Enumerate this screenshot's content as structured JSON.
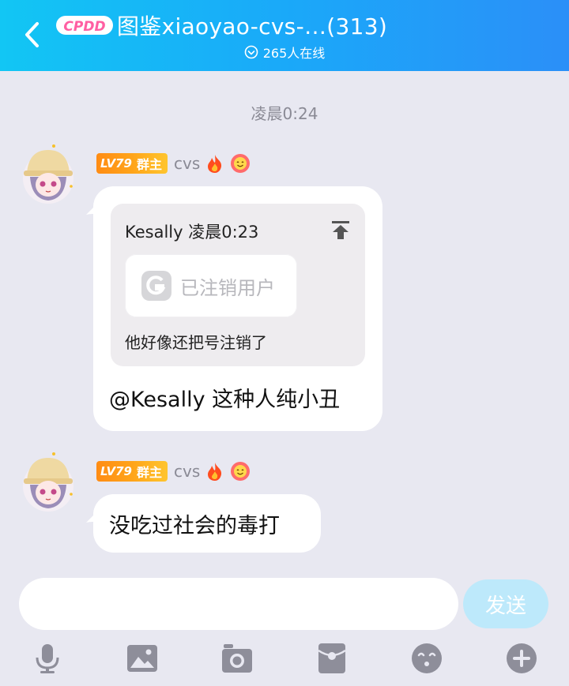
{
  "header": {
    "logo_text": "CPDD",
    "title": "图鉴xiaoyao-cvs-…(313)",
    "online": "265人在线"
  },
  "chat": {
    "timestamp": "凌晨0:24",
    "messages": [
      {
        "level": "LV79",
        "role": "群主",
        "sender": "cvs",
        "quote": {
          "header": "Kesally 凌晨0:23",
          "card_text": "已注销用户",
          "text": "他好像还把号注销了"
        },
        "text": "@Kesally 这种人纯小丑"
      },
      {
        "level": "LV79",
        "role": "群主",
        "sender": "cvs",
        "text": "没吃过社会的毒打"
      }
    ]
  },
  "composer": {
    "input_value": "",
    "send_label": "发送"
  },
  "toolbar": {
    "icons": [
      "microphone-icon",
      "image-icon",
      "camera-icon",
      "red-packet-icon",
      "emoji-icon",
      "plus-icon"
    ]
  },
  "colors": {
    "header_start": "#12c6f4",
    "header_end": "#2b8ff8",
    "badge": "#ffa41a",
    "send_disabled": "#bde9fb",
    "toolbar_icon": "#8e8e9a"
  }
}
